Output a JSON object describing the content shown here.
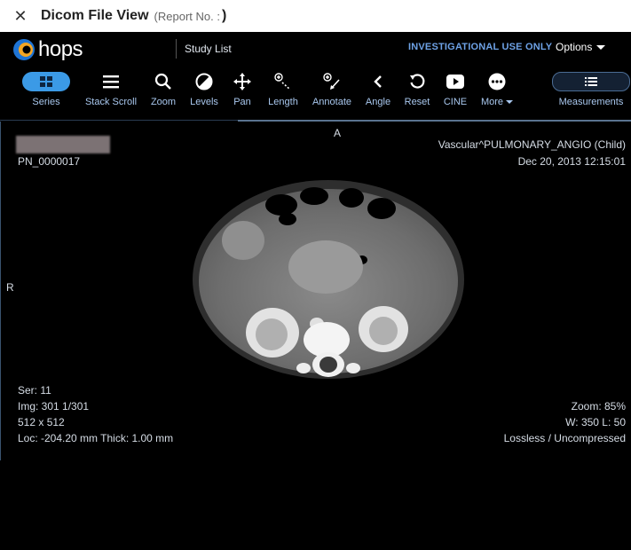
{
  "window": {
    "title": "Dicom File View",
    "report_label": "(Report No. :",
    "report_close": ")",
    "close_glyph": "✕"
  },
  "header": {
    "logo_text": "hops",
    "study_list": "Study List",
    "notice": "INVESTIGATIONAL USE ONLY",
    "options": "Options"
  },
  "toolbar": {
    "items": [
      {
        "label": "Series",
        "icon": "grid-icon"
      },
      {
        "label": "Stack Scroll",
        "icon": "hamburger-icon"
      },
      {
        "label": "Zoom",
        "icon": "search-icon"
      },
      {
        "label": "Levels",
        "icon": "contrast-icon"
      },
      {
        "label": "Pan",
        "icon": "move-icon"
      },
      {
        "label": "Length",
        "icon": "ruler-icon"
      },
      {
        "label": "Annotate",
        "icon": "annotate-icon"
      },
      {
        "label": "Angle",
        "icon": "angle-icon"
      },
      {
        "label": "Reset",
        "icon": "reset-icon"
      },
      {
        "label": "CINE",
        "icon": "play-icon"
      },
      {
        "label": "More",
        "icon": "more-icon"
      },
      {
        "label": "Measurements",
        "icon": "list-icon"
      }
    ]
  },
  "viewer": {
    "orientation_top": "A",
    "orientation_left": "R",
    "patient_id": "PN_0000017",
    "study_desc": "Vascular^PULMONARY_ANGIO (Child)",
    "study_date": "Dec 20, 2013 12:15:01",
    "series": "Ser: 11",
    "image": "Img: 301 1/301",
    "matrix": "512 x 512",
    "location": "Loc: -204.20 mm Thick: 1.00 mm",
    "zoom": "Zoom: 85%",
    "window_level": "W: 350 L: 50",
    "compression": "Lossless / Uncompressed"
  },
  "colors": {
    "accent": "#3b9ae6",
    "tool_text": "#a9c8ef",
    "notice": "#6ea2e6"
  }
}
